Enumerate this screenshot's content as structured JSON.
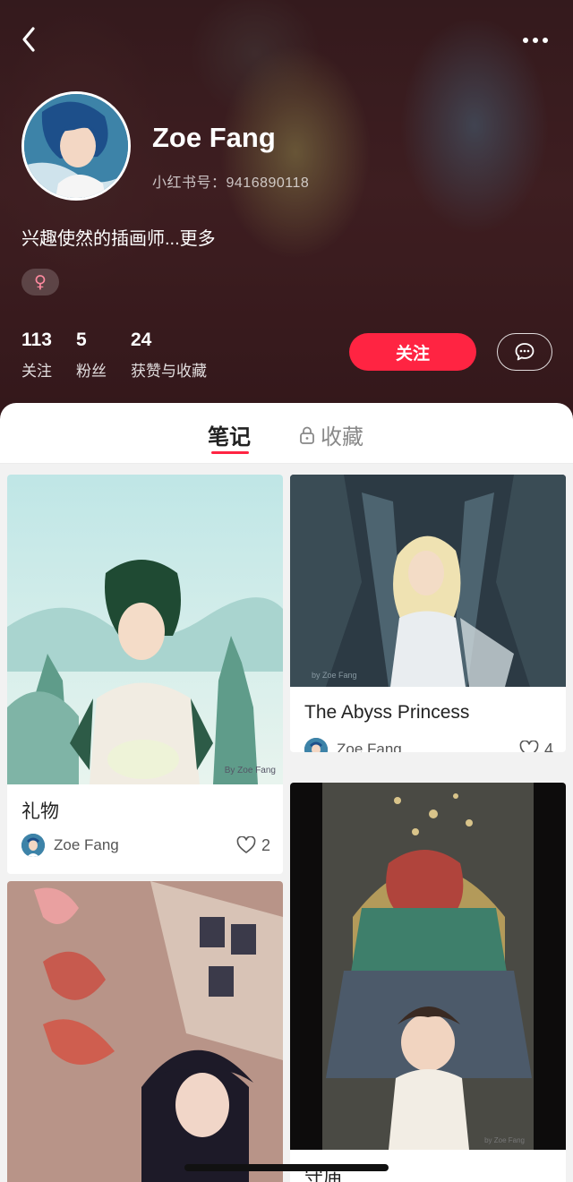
{
  "profile": {
    "name": "Zoe Fang",
    "id_text": "小红书号：9416890118",
    "bio": "兴趣使然的插画师...更多",
    "gender_symbol": "♀",
    "stats": [
      {
        "num": "113",
        "label": "关注"
      },
      {
        "num": "5",
        "label": "粉丝"
      },
      {
        "num": "24",
        "label": "获赞与收藏"
      }
    ],
    "follow_label": "关注"
  },
  "tabs": {
    "notes": "笔记",
    "collections": "收藏"
  },
  "notes": [
    {
      "title": "礼物",
      "author": "Zoe Fang",
      "likes": "2",
      "watermark": "By Zoe Fang"
    },
    {
      "title": "The Abyss Princess",
      "author": "Zoe Fang",
      "likes": "4",
      "watermark": "by Zoe Fang"
    },
    {
      "title": "",
      "author": "",
      "likes": ""
    },
    {
      "title": "守庙",
      "author": "",
      "likes": "",
      "watermark": "by Zoe Fang"
    }
  ],
  "colors": {
    "accent": "#ff2442",
    "header_bg": "#3b1f22"
  },
  "icons": {
    "back": "chevron-left-icon",
    "more": "more-dots-icon",
    "message": "chat-bubble-icon",
    "lock": "lock-icon",
    "heart": "heart-outline-icon"
  }
}
